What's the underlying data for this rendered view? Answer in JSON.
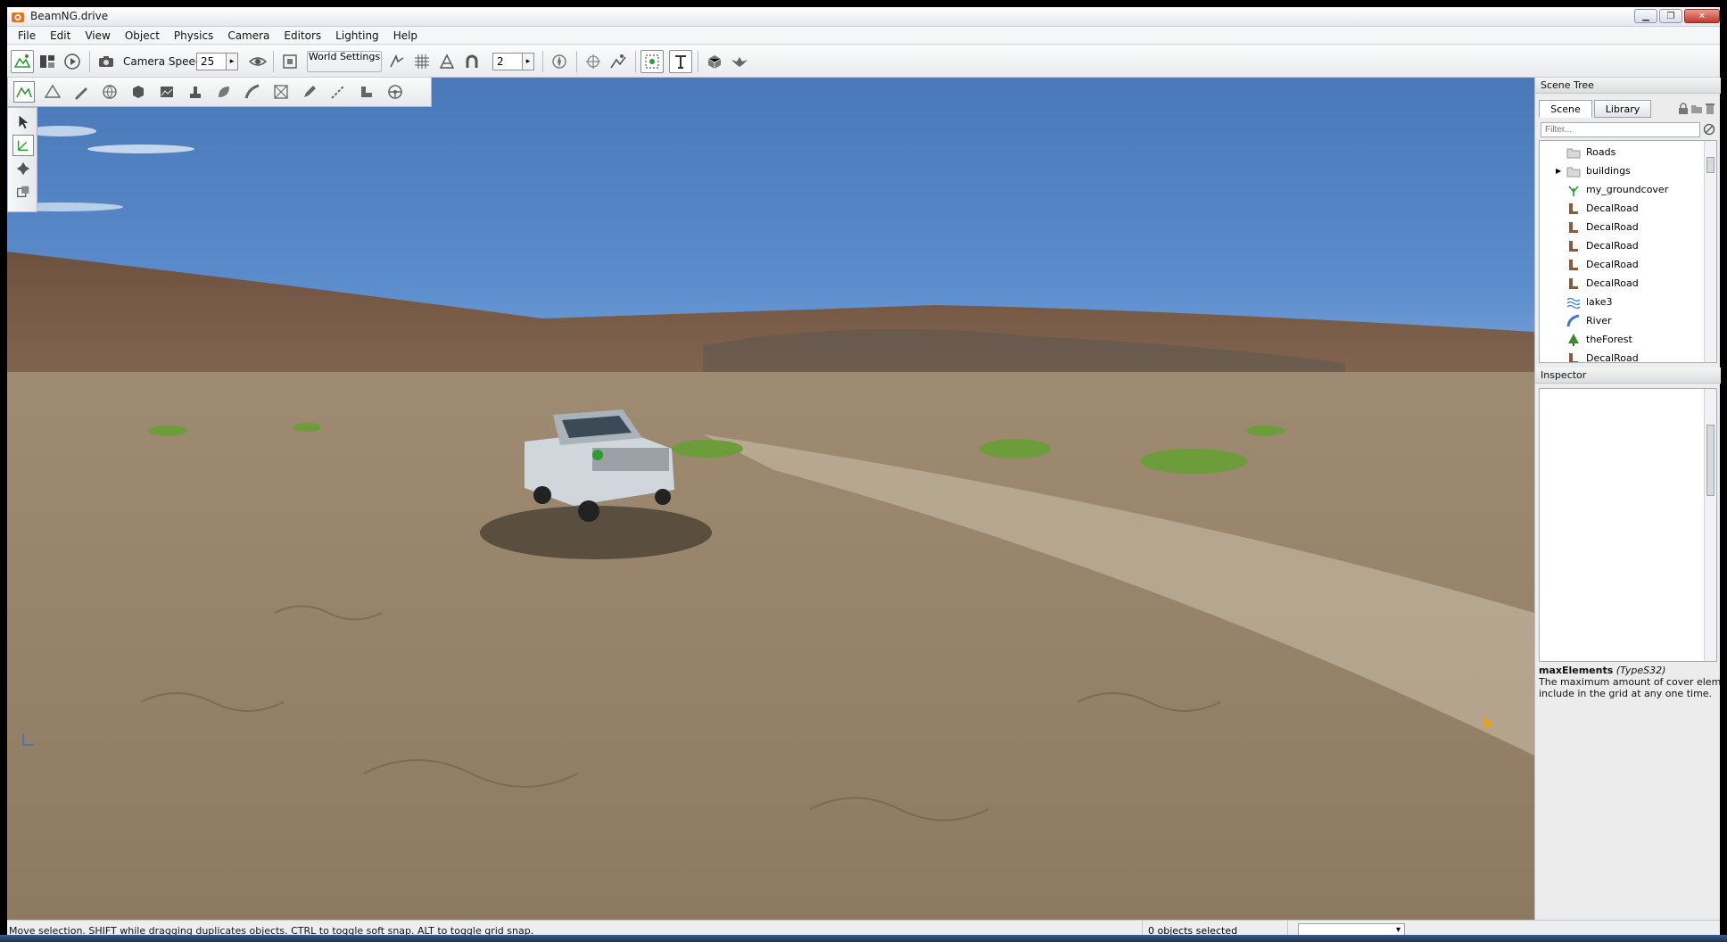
{
  "window": {
    "title": "BeamNG.drive",
    "minimize_glyph": "▁",
    "restore_glyph": "❐",
    "close_glyph": "✕"
  },
  "menu": [
    "File",
    "Edit",
    "View",
    "Object",
    "Physics",
    "Camera",
    "Editors",
    "Lighting",
    "Help"
  ],
  "toolbar": {
    "camera_speed_label": "Camera Speed",
    "camera_speed_value": "25",
    "world_settings_label": "World Settings",
    "snap_value": "2",
    "spin_arrow": "▸"
  },
  "scene_tree": {
    "header": "Scene Tree",
    "tabs": [
      "Scene",
      "Library"
    ],
    "filter_placeholder": "Filter...",
    "items": [
      {
        "label": "Roads",
        "icon": "folder-icon"
      },
      {
        "label": "buildings",
        "icon": "folder-icon"
      },
      {
        "label": "my_groundcover",
        "icon": "groundcover-icon"
      },
      {
        "label": "DecalRoad",
        "icon": "decalroad-icon"
      },
      {
        "label": "DecalRoad",
        "icon": "decalroad-icon"
      },
      {
        "label": "DecalRoad",
        "icon": "decalroad-icon"
      },
      {
        "label": "DecalRoad",
        "icon": "decalroad-icon"
      },
      {
        "label": "DecalRoad",
        "icon": "decalroad-icon"
      },
      {
        "label": "lake3",
        "icon": "water-icon"
      },
      {
        "label": "River",
        "icon": "river-icon"
      },
      {
        "label": "theForest",
        "icon": "forest-icon"
      },
      {
        "label": "DecalRoad",
        "icon": "decalroad-icon"
      }
    ]
  },
  "inspector": {
    "header": "Inspector",
    "field_name": "maxElements",
    "field_type": "(TypeS32)",
    "field_desc_line1": "The maximum amount of cover elements to",
    "field_desc_line2": "include in the grid at any one time."
  },
  "status": {
    "hint": "Move selection.  SHIFT while dragging duplicates objects.  CTRL to toggle soft snap.  ALT to toggle grid snap.",
    "selection": "0 objects selected"
  },
  "colors": {
    "sky_top": "#4a78b8",
    "ground": "#9b8466",
    "accent_green": "#2f9a2f"
  }
}
